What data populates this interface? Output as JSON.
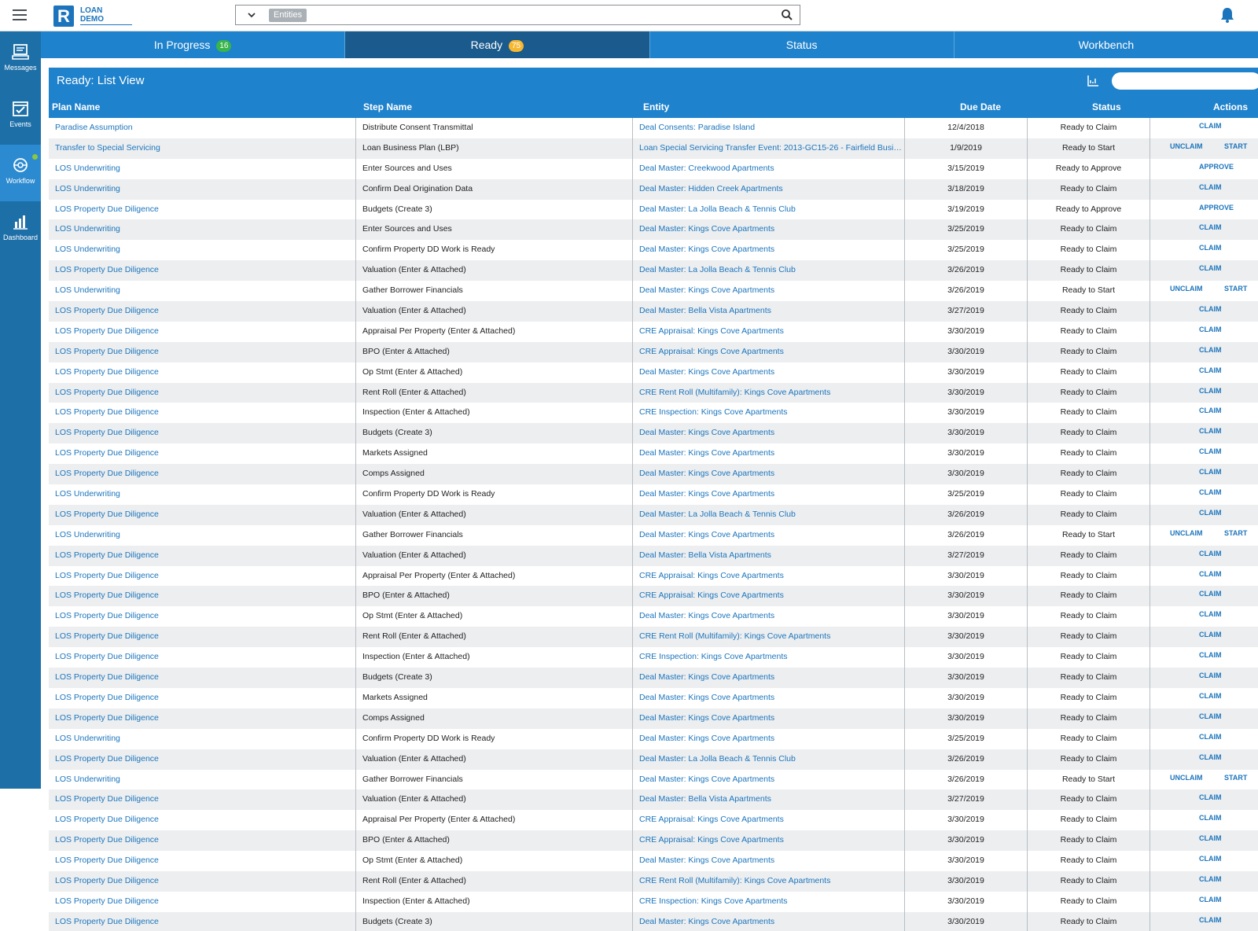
{
  "header": {
    "logo_letter": "R",
    "logo_line1": "LOAN",
    "logo_line2": "DEMO",
    "search_chip": "Entities"
  },
  "sidebar": {
    "items": [
      {
        "label": "Messages",
        "icon": "messages-icon"
      },
      {
        "label": "Events",
        "icon": "events-icon"
      },
      {
        "label": "Workflow",
        "icon": "workflow-icon"
      },
      {
        "label": "Dashboard",
        "icon": "dashboard-icon"
      }
    ]
  },
  "tabs": [
    {
      "label": "In Progress",
      "badge": "16"
    },
    {
      "label": "Ready",
      "badge": "75"
    },
    {
      "label": "Status",
      "badge": ""
    },
    {
      "label": "Workbench",
      "badge": ""
    }
  ],
  "panel": {
    "title": "Ready: List View"
  },
  "table": {
    "headers": {
      "plan": "Plan Name",
      "step": "Step Name",
      "entity": "Entity",
      "due": "Due Date",
      "status": "Status",
      "actions": "Actions"
    },
    "rows": [
      {
        "plan": "Paradise Assumption",
        "step": "Distribute Consent Transmittal",
        "entity": "Deal Consents: Paradise Island",
        "due": "12/4/2018",
        "status": "Ready to Claim",
        "actions": [
          "CLAIM"
        ]
      },
      {
        "plan": "Transfer to Special Servicing",
        "step": "Loan Business Plan (LBP)",
        "entity": "Loan Special Servicing Transfer Event: 2013-GC15-26 - Fairfield Business ...",
        "due": "1/9/2019",
        "status": "Ready to Start",
        "actions": [
          "UNCLAIM",
          "START"
        ]
      },
      {
        "plan": "LOS Underwriting",
        "step": "Enter Sources and Uses",
        "entity": "Deal Master: Creekwood Apartments",
        "due": "3/15/2019",
        "status": "Ready to Approve",
        "actions": [
          "APPROVE"
        ]
      },
      {
        "plan": "LOS Underwriting",
        "step": "Confirm Deal Origination Data",
        "entity": "Deal Master: Hidden Creek Apartments",
        "due": "3/18/2019",
        "status": "Ready to Claim",
        "actions": [
          "CLAIM"
        ]
      },
      {
        "plan": "LOS Property Due Diligence",
        "step": "Budgets (Create 3)",
        "entity": "Deal Master: La Jolla Beach & Tennis Club",
        "due": "3/19/2019",
        "status": "Ready to Approve",
        "actions": [
          "APPROVE"
        ]
      },
      {
        "plan": "LOS Underwriting",
        "step": "Enter Sources and Uses",
        "entity": "Deal Master: Kings Cove Apartments",
        "due": "3/25/2019",
        "status": "Ready to Claim",
        "actions": [
          "CLAIM"
        ]
      },
      {
        "plan": "LOS Underwriting",
        "step": "Confirm Property DD Work is Ready",
        "entity": "Deal Master: Kings Cove Apartments",
        "due": "3/25/2019",
        "status": "Ready to Claim",
        "actions": [
          "CLAIM"
        ]
      },
      {
        "plan": "LOS Property Due Diligence",
        "step": "Valuation (Enter & Attached)",
        "entity": "Deal Master: La Jolla Beach & Tennis Club",
        "due": "3/26/2019",
        "status": "Ready to Claim",
        "actions": [
          "CLAIM"
        ]
      },
      {
        "plan": "LOS Underwriting",
        "step": "Gather Borrower Financials",
        "entity": "Deal Master: Kings Cove Apartments",
        "due": "3/26/2019",
        "status": "Ready to Start",
        "actions": [
          "UNCLAIM",
          "START"
        ]
      },
      {
        "plan": "LOS Property Due Diligence",
        "step": "Valuation (Enter & Attached)",
        "entity": "Deal Master: Bella Vista Apartments",
        "due": "3/27/2019",
        "status": "Ready to Claim",
        "actions": [
          "CLAIM"
        ]
      },
      {
        "plan": "LOS Property Due Diligence",
        "step": "Appraisal Per Property (Enter & Attached)",
        "entity": "CRE Appraisal: Kings Cove Apartments",
        "due": "3/30/2019",
        "status": "Ready to Claim",
        "actions": [
          "CLAIM"
        ]
      },
      {
        "plan": "LOS Property Due Diligence",
        "step": "BPO (Enter & Attached)",
        "entity": "CRE Appraisal: Kings Cove Apartments",
        "due": "3/30/2019",
        "status": "Ready to Claim",
        "actions": [
          "CLAIM"
        ]
      },
      {
        "plan": "LOS Property Due Diligence",
        "step": "Op Stmt (Enter & Attached)",
        "entity": "Deal Master: Kings Cove Apartments",
        "due": "3/30/2019",
        "status": "Ready to Claim",
        "actions": [
          "CLAIM"
        ]
      },
      {
        "plan": "LOS Property Due Diligence",
        "step": "Rent Roll (Enter & Attached)",
        "entity": "CRE Rent Roll (Multifamily): Kings Cove Apartments",
        "due": "3/30/2019",
        "status": "Ready to Claim",
        "actions": [
          "CLAIM"
        ]
      },
      {
        "plan": "LOS Property Due Diligence",
        "step": "Inspection (Enter & Attached)",
        "entity": "CRE Inspection: Kings Cove Apartments",
        "due": "3/30/2019",
        "status": "Ready to Claim",
        "actions": [
          "CLAIM"
        ]
      },
      {
        "plan": "LOS Property Due Diligence",
        "step": "Budgets (Create 3)",
        "entity": "Deal Master: Kings Cove Apartments",
        "due": "3/30/2019",
        "status": "Ready to Claim",
        "actions": [
          "CLAIM"
        ]
      },
      {
        "plan": "LOS Property Due Diligence",
        "step": "Markets Assigned",
        "entity": "Deal Master: Kings Cove Apartments",
        "due": "3/30/2019",
        "status": "Ready to Claim",
        "actions": [
          "CLAIM"
        ]
      },
      {
        "plan": "LOS Property Due Diligence",
        "step": "Comps Assigned",
        "entity": "Deal Master: Kings Cove Apartments",
        "due": "3/30/2019",
        "status": "Ready to Claim",
        "actions": [
          "CLAIM"
        ]
      },
      {
        "plan": "LOS Underwriting",
        "step": "Confirm Property DD Work is Ready",
        "entity": "Deal Master: Kings Cove Apartments",
        "due": "3/25/2019",
        "status": "Ready to Claim",
        "actions": [
          "CLAIM"
        ]
      },
      {
        "plan": "LOS Property Due Diligence",
        "step": "Valuation (Enter & Attached)",
        "entity": "Deal Master: La Jolla Beach & Tennis Club",
        "due": "3/26/2019",
        "status": "Ready to Claim",
        "actions": [
          "CLAIM"
        ]
      },
      {
        "plan": "LOS Underwriting",
        "step": "Gather Borrower Financials",
        "entity": "Deal Master: Kings Cove Apartments",
        "due": "3/26/2019",
        "status": "Ready to Start",
        "actions": [
          "UNCLAIM",
          "START"
        ]
      },
      {
        "plan": "LOS Property Due Diligence",
        "step": "Valuation (Enter & Attached)",
        "entity": "Deal Master: Bella Vista Apartments",
        "due": "3/27/2019",
        "status": "Ready to Claim",
        "actions": [
          "CLAIM"
        ]
      },
      {
        "plan": "LOS Property Due Diligence",
        "step": "Appraisal Per Property (Enter & Attached)",
        "entity": "CRE Appraisal: Kings Cove Apartments",
        "due": "3/30/2019",
        "status": "Ready to Claim",
        "actions": [
          "CLAIM"
        ]
      },
      {
        "plan": "LOS Property Due Diligence",
        "step": "BPO (Enter & Attached)",
        "entity": "CRE Appraisal: Kings Cove Apartments",
        "due": "3/30/2019",
        "status": "Ready to Claim",
        "actions": [
          "CLAIM"
        ]
      },
      {
        "plan": "LOS Property Due Diligence",
        "step": "Op Stmt (Enter & Attached)",
        "entity": "Deal Master: Kings Cove Apartments",
        "due": "3/30/2019",
        "status": "Ready to Claim",
        "actions": [
          "CLAIM"
        ]
      },
      {
        "plan": "LOS Property Due Diligence",
        "step": "Rent Roll (Enter & Attached)",
        "entity": "CRE Rent Roll (Multifamily): Kings Cove Apartments",
        "due": "3/30/2019",
        "status": "Ready to Claim",
        "actions": [
          "CLAIM"
        ]
      },
      {
        "plan": "LOS Property Due Diligence",
        "step": "Inspection (Enter & Attached)",
        "entity": "CRE Inspection: Kings Cove Apartments",
        "due": "3/30/2019",
        "status": "Ready to Claim",
        "actions": [
          "CLAIM"
        ]
      },
      {
        "plan": "LOS Property Due Diligence",
        "step": "Budgets (Create 3)",
        "entity": "Deal Master: Kings Cove Apartments",
        "due": "3/30/2019",
        "status": "Ready to Claim",
        "actions": [
          "CLAIM"
        ]
      },
      {
        "plan": "LOS Property Due Diligence",
        "step": "Markets Assigned",
        "entity": "Deal Master: Kings Cove Apartments",
        "due": "3/30/2019",
        "status": "Ready to Claim",
        "actions": [
          "CLAIM"
        ]
      },
      {
        "plan": "LOS Property Due Diligence",
        "step": "Comps Assigned",
        "entity": "Deal Master: Kings Cove Apartments",
        "due": "3/30/2019",
        "status": "Ready to Claim",
        "actions": [
          "CLAIM"
        ]
      },
      {
        "plan": "LOS Underwriting",
        "step": "Confirm Property DD Work is Ready",
        "entity": "Deal Master: Kings Cove Apartments",
        "due": "3/25/2019",
        "status": "Ready to Claim",
        "actions": [
          "CLAIM"
        ]
      },
      {
        "plan": "LOS Property Due Diligence",
        "step": "Valuation (Enter & Attached)",
        "entity": "Deal Master: La Jolla Beach & Tennis Club",
        "due": "3/26/2019",
        "status": "Ready to Claim",
        "actions": [
          "CLAIM"
        ]
      },
      {
        "plan": "LOS Underwriting",
        "step": "Gather Borrower Financials",
        "entity": "Deal Master: Kings Cove Apartments",
        "due": "3/26/2019",
        "status": "Ready to Start",
        "actions": [
          "UNCLAIM",
          "START"
        ]
      },
      {
        "plan": "LOS Property Due Diligence",
        "step": "Valuation (Enter & Attached)",
        "entity": "Deal Master: Bella Vista Apartments",
        "due": "3/27/2019",
        "status": "Ready to Claim",
        "actions": [
          "CLAIM"
        ]
      },
      {
        "plan": "LOS Property Due Diligence",
        "step": "Appraisal Per Property (Enter & Attached)",
        "entity": "CRE Appraisal: Kings Cove Apartments",
        "due": "3/30/2019",
        "status": "Ready to Claim",
        "actions": [
          "CLAIM"
        ]
      },
      {
        "plan": "LOS Property Due Diligence",
        "step": "BPO (Enter & Attached)",
        "entity": "CRE Appraisal: Kings Cove Apartments",
        "due": "3/30/2019",
        "status": "Ready to Claim",
        "actions": [
          "CLAIM"
        ]
      },
      {
        "plan": "LOS Property Due Diligence",
        "step": "Op Stmt (Enter & Attached)",
        "entity": "Deal Master: Kings Cove Apartments",
        "due": "3/30/2019",
        "status": "Ready to Claim",
        "actions": [
          "CLAIM"
        ]
      },
      {
        "plan": "LOS Property Due Diligence",
        "step": "Rent Roll (Enter & Attached)",
        "entity": "CRE Rent Roll (Multifamily): Kings Cove Apartments",
        "due": "3/30/2019",
        "status": "Ready to Claim",
        "actions": [
          "CLAIM"
        ]
      },
      {
        "plan": "LOS Property Due Diligence",
        "step": "Inspection (Enter & Attached)",
        "entity": "CRE Inspection: Kings Cove Apartments",
        "due": "3/30/2019",
        "status": "Ready to Claim",
        "actions": [
          "CLAIM"
        ]
      },
      {
        "plan": "LOS Property Due Diligence",
        "step": "Budgets (Create 3)",
        "entity": "Deal Master: Kings Cove Apartments",
        "due": "3/30/2019",
        "status": "Ready to Claim",
        "actions": [
          "CLAIM"
        ]
      }
    ]
  }
}
